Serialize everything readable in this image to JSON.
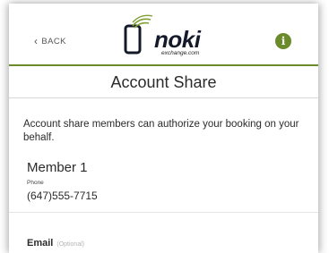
{
  "header": {
    "back_label": "BACK",
    "logo_word": "noki",
    "logo_sub": "exchange.com",
    "info_glyph": "i",
    "accent_color": "#6b8a2b"
  },
  "page": {
    "title": "Account Share",
    "intro": "Account share members can authorize your booking on your behalf."
  },
  "member": {
    "title": "Member 1",
    "phone_label": "Phone",
    "phone_value": "(647)555-7715"
  },
  "email": {
    "label": "Email",
    "optional": "(Optional)"
  }
}
